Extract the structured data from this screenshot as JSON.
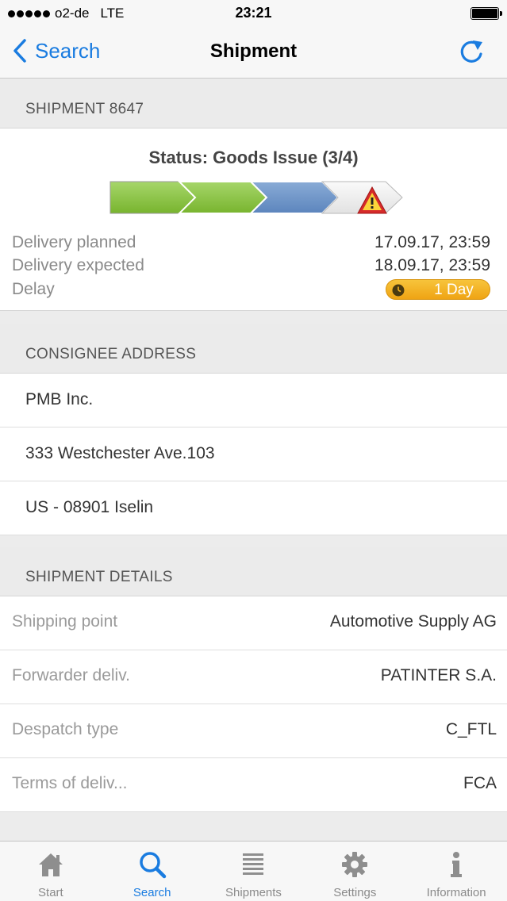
{
  "status_bar": {
    "carrier": "o2-de",
    "network": "LTE",
    "time": "23:21"
  },
  "nav": {
    "back_label": "Search",
    "title": "Shipment"
  },
  "shipment_header": "SHIPMENT 8647",
  "status": {
    "title": "Status: Goods Issue (3/4)",
    "steps_completed": 3,
    "steps_total": 4,
    "delivery_planned_label": "Delivery planned",
    "delivery_planned_value": "17.09.17, 23:59",
    "delivery_expected_label": "Delivery expected",
    "delivery_expected_value": "18.09.17, 23:59",
    "delay_label": "Delay",
    "delay_value": "1 Day"
  },
  "consignee": {
    "header": "CONSIGNEE ADDRESS",
    "lines": [
      "PMB Inc.",
      "333 Westchester Ave.103",
      "US - 08901 Iselin"
    ]
  },
  "details": {
    "header": "SHIPMENT DETAILS",
    "rows": [
      {
        "label": "Shipping point",
        "value": "Automotive Supply AG"
      },
      {
        "label": "Forwarder deliv.",
        "value": "PATINTER S.A."
      },
      {
        "label": "Despatch type",
        "value": "C_FTL"
      },
      {
        "label": "Terms of deliv...",
        "value": "FCA"
      }
    ]
  },
  "tabs": [
    {
      "label": "Start",
      "icon": "home-icon"
    },
    {
      "label": "Search",
      "icon": "search-icon"
    },
    {
      "label": "Shipments",
      "icon": "list-icon"
    },
    {
      "label": "Settings",
      "icon": "gear-icon"
    },
    {
      "label": "Information",
      "icon": "info-icon"
    }
  ],
  "colors": {
    "accent": "#1a7ce0",
    "step_done": "#8cc63f",
    "step_current": "#6a92c8",
    "step_pending": "#eeeeee",
    "delay_badge": "#f2b01f",
    "warning": "#d62a2a"
  }
}
